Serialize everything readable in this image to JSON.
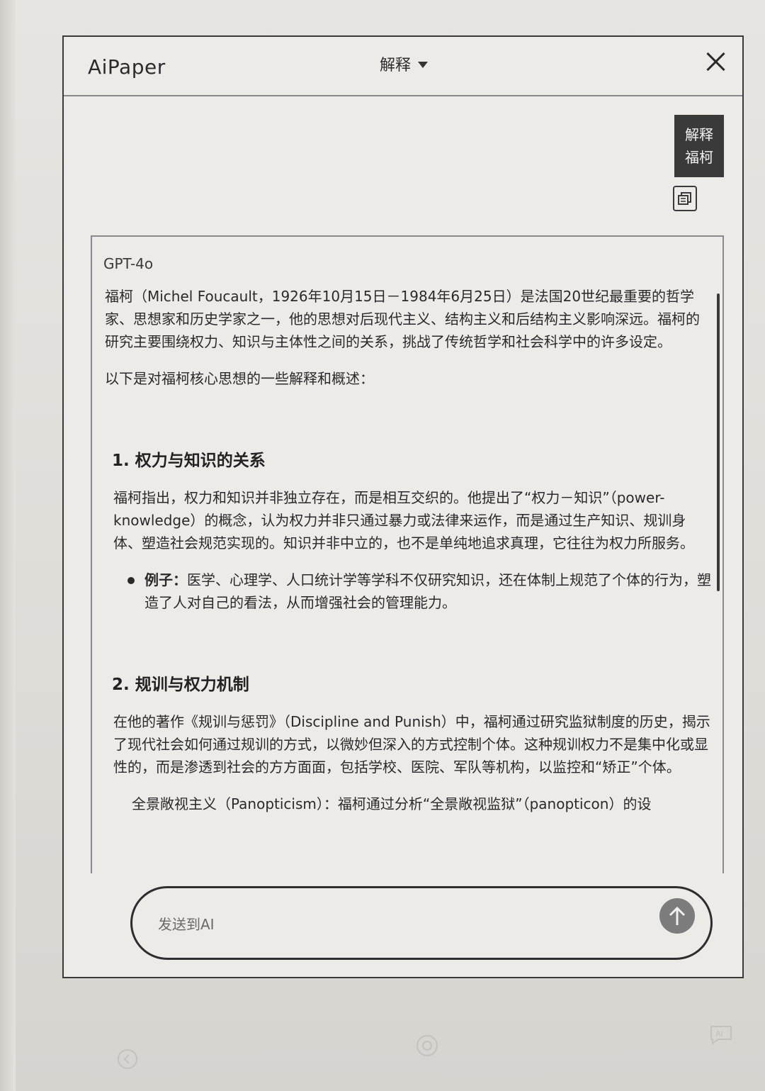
{
  "header": {
    "app_title": "AiPaper",
    "mode_label": "解释"
  },
  "user_message": {
    "line1": "解释",
    "line2": "福柯"
  },
  "answer": {
    "model": "GPT-4o",
    "intro": "福柯（Michel Foucault，1926年10月15日－1984年6月25日）是法国20世纪最重要的哲学家、思想家和历史学家之一，他的思想对后现代主义、结构主义和后结构主义影响深远。福柯的研究主要围绕权力、知识与主体性之间的关系，挑战了传统哲学和社会科学中的许多设定。",
    "lead": "以下是对福柯核心思想的一些解释和概述：",
    "sections": [
      {
        "heading": "1. 权力与知识的关系",
        "body": "福柯指出，权力和知识并非独立存在，而是相互交织的。他提出了“权力－知识”（power-knowledge）的概念，认为权力并非只通过暴力或法律来运作，而是通过生产知识、规训身体、塑造社会规范实现的。知识并非中立的，也不是单纯地追求真理，它往往为权力所服务。",
        "bullet_label": "例子：",
        "bullet_text": "医学、心理学、人口统计学等学科不仅研究知识，还在体制上规范了个体的行为，塑造了人对自己的看法，从而增强社会的管理能力。"
      },
      {
        "heading": "2. 规训与权力机制",
        "body": "在他的著作《规训与惩罚》（Discipline and Punish）中，福柯通过研究监狱制度的历史，揭示了现代社会如何通过规训的方式，以微妙但深入的方式控制个体。这种规训权力不是集中化或显性的，而是渗透到社会的方方面面，包括学校、医院、军队等机构，以监控和“矫正”个体。",
        "cut_line": "全景敞视主义（Panopticism）：福柯通过分析“全景敞视监狱”（panopticon）的设"
      }
    ]
  },
  "input": {
    "placeholder": "发送到AI"
  }
}
